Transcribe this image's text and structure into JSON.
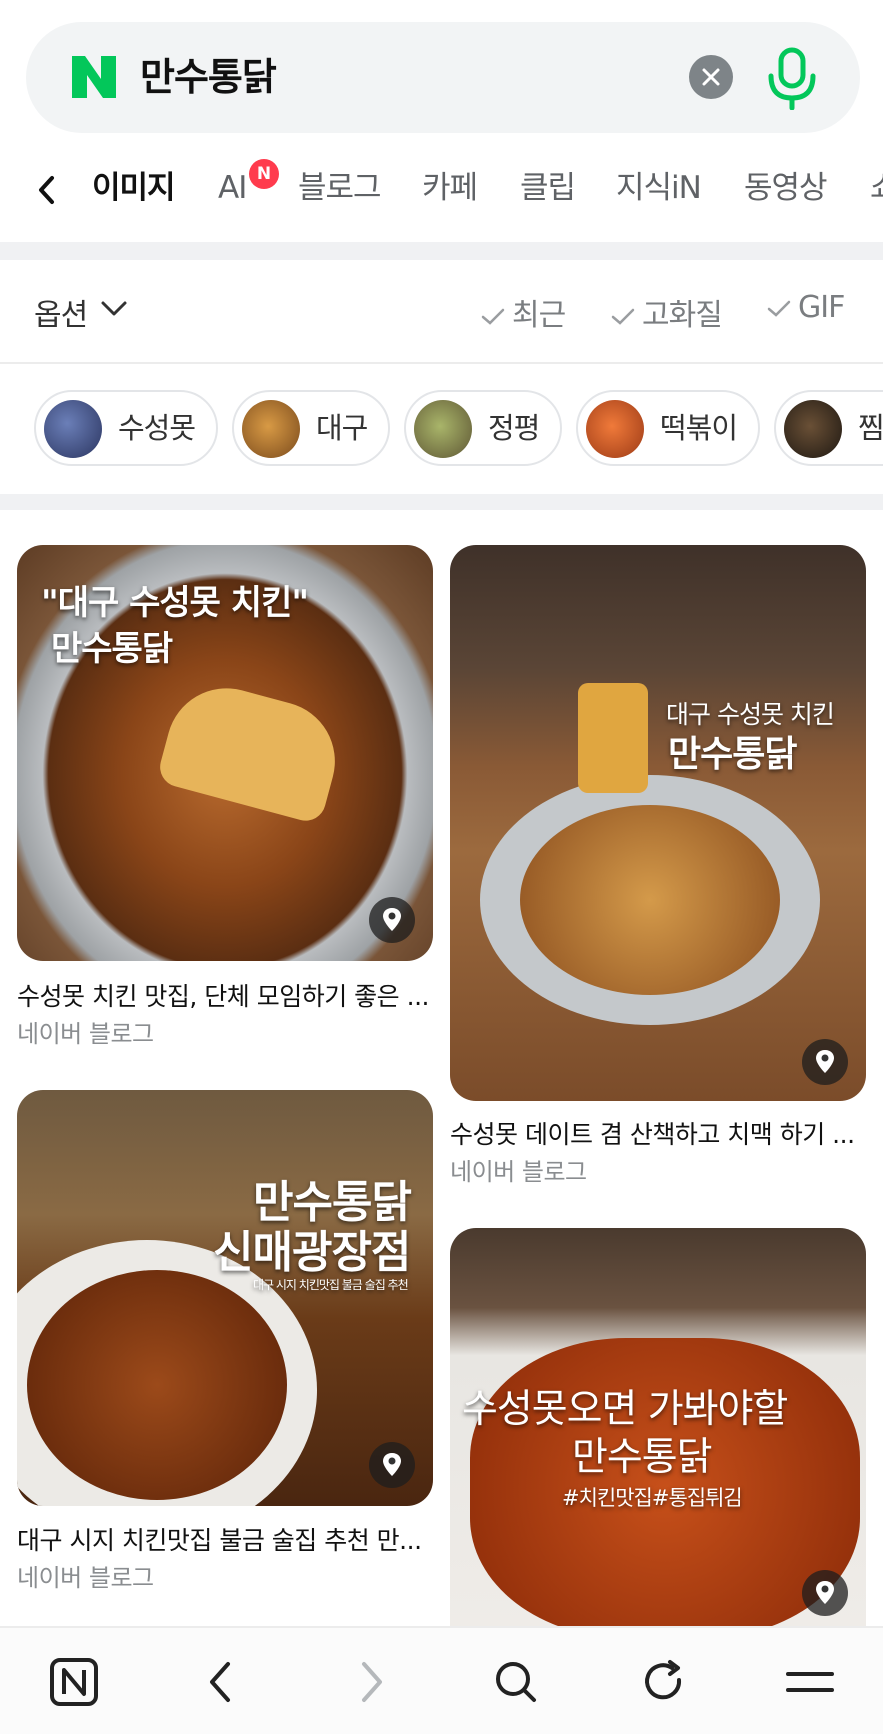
{
  "search": {
    "logo_letter": "N",
    "query": "만수통닭",
    "clear_icon": "close-icon",
    "mic_icon": "microphone-icon"
  },
  "tabs": {
    "items": [
      "이미지",
      "AI",
      "블로그",
      "카페",
      "클립",
      "지식iN",
      "동영상",
      "쇼"
    ],
    "active": "이미지",
    "ai_badge": "N"
  },
  "options": {
    "label": "옵션",
    "filters": [
      "최근",
      "고화질",
      "GIF"
    ]
  },
  "chips": [
    "수성못",
    "대구",
    "정평",
    "떡볶이",
    "찜"
  ],
  "results": [
    {
      "overlay_lines": [
        "\"대구 수성못 치킨\"",
        "만수통닭"
      ],
      "title": "수성못 치킨 맛집, 단체 모임하기 좋은 ...",
      "source": "네이버 블로그"
    },
    {
      "overlay_lines": [
        "대구 수성못 치킨",
        "만수통닭"
      ],
      "title": "수성못 데이트 겸 산책하고 치맥 하기 ...",
      "source": "네이버 블로그"
    },
    {
      "overlay_lines": [
        "만수통닭",
        "신매광장점",
        "대구 시지 치킨맛집 불금 술집 추천"
      ],
      "title": "대구 시지 치킨맛집 불금 술집 추천 만...",
      "source": "네이버 블로그"
    },
    {
      "overlay_lines": [
        "수성못오면 가봐야할",
        "만수통닭",
        "#치킨맛집#통집튀김"
      ],
      "title": "",
      "source": ""
    }
  ],
  "colors": {
    "naver_green": "#03c75a",
    "badge_red": "#ff3b4d",
    "muted_text": "#8a8d90"
  }
}
